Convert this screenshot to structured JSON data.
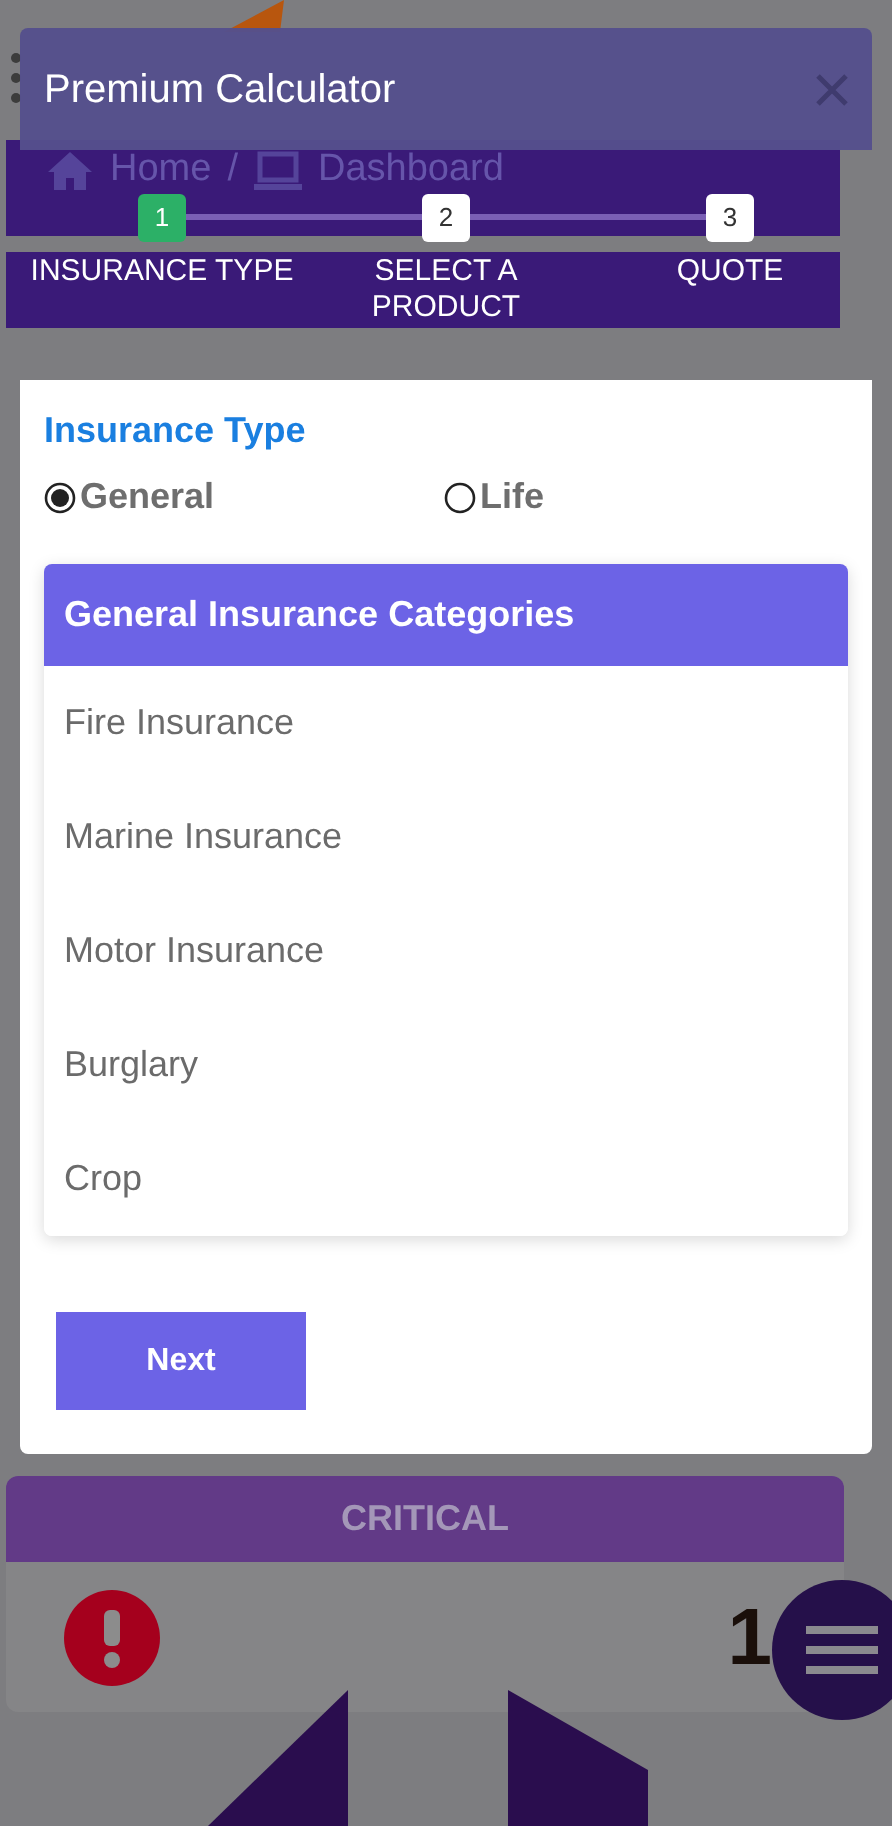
{
  "background": {
    "breadcrumb": [
      {
        "label": "Home"
      },
      {
        "label": "Dashboard"
      }
    ],
    "separator": "/",
    "card_title": "CRITICAL",
    "card_count": "1"
  },
  "modal": {
    "title": "Premium Calculator"
  },
  "steps": [
    {
      "number": "1",
      "label": "INSURANCE TYPE",
      "selected": true
    },
    {
      "number": "2",
      "label": "SELECT A PRODUCT",
      "selected": false
    },
    {
      "number": "3",
      "label": "QUOTE",
      "selected": false
    }
  ],
  "section_title": "Insurance Type",
  "insurance_types": [
    {
      "label": "General",
      "selected": true
    },
    {
      "label": "Life",
      "selected": false
    }
  ],
  "categories": {
    "title": "General Insurance Categories",
    "items": [
      "Fire Insurance",
      "Marine Insurance",
      "Motor Insurance",
      "Burglary",
      "Crop"
    ]
  },
  "next_button": "Next"
}
